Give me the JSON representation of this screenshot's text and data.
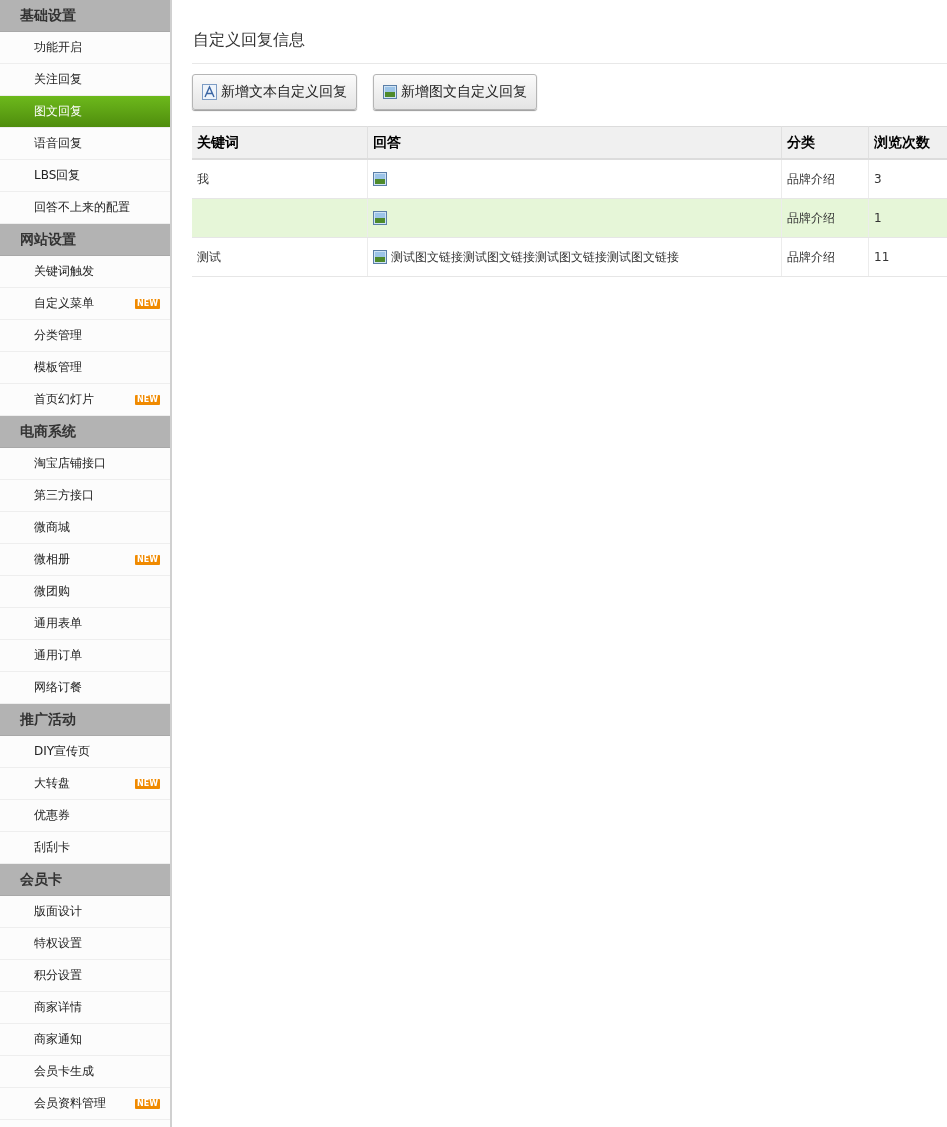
{
  "sidebar": {
    "sections": [
      {
        "title": "基础设置",
        "items": [
          {
            "label": "功能开启",
            "selected": false
          },
          {
            "label": "关注回复",
            "selected": false
          },
          {
            "label": "图文回复",
            "selected": true
          },
          {
            "label": "语音回复",
            "selected": false
          },
          {
            "label": "LBS回复",
            "selected": false
          },
          {
            "label": "回答不上来的配置",
            "selected": false
          }
        ]
      },
      {
        "title": "网站设置",
        "items": [
          {
            "label": "关键词触发",
            "selected": false
          },
          {
            "label": "自定义菜单",
            "selected": false,
            "badge": "NEW"
          },
          {
            "label": "分类管理",
            "selected": false
          },
          {
            "label": "模板管理",
            "selected": false
          },
          {
            "label": "首页幻灯片",
            "selected": false,
            "badge": "NEW"
          }
        ]
      },
      {
        "title": "电商系统",
        "items": [
          {
            "label": "淘宝店铺接口",
            "selected": false
          },
          {
            "label": "第三方接口",
            "selected": false
          },
          {
            "label": "微商城",
            "selected": false
          },
          {
            "label": "微相册",
            "selected": false,
            "badge": "NEW"
          },
          {
            "label": "微团购",
            "selected": false
          },
          {
            "label": "通用表单",
            "selected": false
          },
          {
            "label": "通用订单",
            "selected": false
          },
          {
            "label": "网络订餐",
            "selected": false
          }
        ]
      },
      {
        "title": "推广活动",
        "items": [
          {
            "label": "DIY宣传页",
            "selected": false
          },
          {
            "label": "大转盘",
            "selected": false,
            "badge": "NEW"
          },
          {
            "label": "优惠券",
            "selected": false
          },
          {
            "label": "刮刮卡",
            "selected": false
          }
        ]
      },
      {
        "title": "会员卡",
        "items": [
          {
            "label": "版面设计",
            "selected": false
          },
          {
            "label": "特权设置",
            "selected": false
          },
          {
            "label": "积分设置",
            "selected": false
          },
          {
            "label": "商家详情",
            "selected": false
          },
          {
            "label": "商家通知",
            "selected": false
          },
          {
            "label": "会员卡生成",
            "selected": false
          },
          {
            "label": "会员资料管理",
            "selected": false,
            "badge": "NEW"
          }
        ]
      }
    ]
  },
  "main": {
    "title": "自定义回复信息",
    "buttons": [
      {
        "label": "新增文本自定义回复",
        "kind": "text"
      },
      {
        "label": "新增图文自定义回复",
        "kind": "image"
      }
    ],
    "table": {
      "columns": [
        "关键词",
        "回答",
        "分类",
        "浏览次数"
      ],
      "rows": [
        {
          "keyword": "我",
          "answer": "",
          "category": "品牌介绍",
          "views": "3",
          "selected": false
        },
        {
          "keyword": "",
          "answer": "",
          "category": "品牌介绍",
          "views": "1",
          "selected": true
        },
        {
          "keyword": "测试",
          "answer": "测试图文链接测试图文链接测试图文链接测试图文链接",
          "category": "品牌介绍",
          "views": "11",
          "selected": false
        }
      ]
    }
  }
}
